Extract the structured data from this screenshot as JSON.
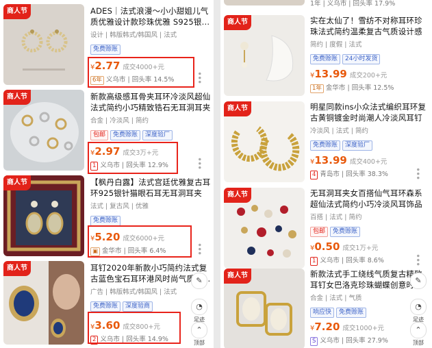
{
  "badge_label": "商人节",
  "left": [
    {
      "title": "ADES｜法式浪漫～小小甜姐儿气质优雅设计款珍珠优雅 S925银...",
      "tags": "设计 | 韩版韩式/韩国风 | 法式",
      "chips": [
        {
          "text": "免费赊账",
          "red": false
        }
      ],
      "currency": "¥",
      "price": "2.77",
      "sold": "成交4000+元",
      "meta_badge": "6年",
      "meta_badge_color": "orange",
      "market": "义乌市",
      "rate": "回头率 14.5%"
    },
    {
      "title": "新款高级感耳骨夹耳环冷淡风超仙法式简约小巧精致锆石无耳洞耳夹",
      "tags": "合金 | 冷淡风 | 简约",
      "chips": [
        {
          "text": "包邮",
          "red": true
        },
        {
          "text": "免费赊账",
          "red": false
        },
        {
          "text": "深度验厂",
          "red": false
        }
      ],
      "currency": "¥",
      "price": "2.97",
      "sold": "成交3万+元",
      "meta_badge": "1",
      "meta_badge_color": "red",
      "market": "义乌市",
      "rate": "回头率 12.9%"
    },
    {
      "title": "【枫丹白露】法式宫廷优雅复古耳环925银针猫眼石耳无耳洞耳夹",
      "tags": "法式 | 复古风 | 优雅",
      "chips": [
        {
          "text": "免费赊账",
          "red": false
        }
      ],
      "currency": "¥",
      "price": "5.20",
      "sold": "成交6000+元",
      "meta_badge": "",
      "meta_badge_color": "orange",
      "market": "金华市",
      "rate": "回头率 6.4%"
    },
    {
      "title": "耳钉2020年新款小巧简约法式复古蓝色宝石耳环港风时尚气质耳...",
      "tags": "广告 | 韩版韩式/韩国风 | 法式",
      "chips": [
        {
          "text": "免费赊账",
          "red": false
        },
        {
          "text": "深度验商",
          "red": false
        }
      ],
      "currency": "¥",
      "price": "3.60",
      "sold": "成交800+元",
      "meta_badge": "2",
      "meta_badge_color": "red",
      "market": "义乌市",
      "rate": "回头率 14.9%"
    }
  ],
  "right_top_meta": "1年 | 义乌市 | 回头率 17.9%",
  "right": [
    {
      "title": "实在太仙了！雪纺不对称耳环珍珠法式简约温柔复古气质设计感度假",
      "tags": "简约 | 度假 | 法式",
      "chips": [
        {
          "text": "免费赊账",
          "red": false
        },
        {
          "text": "24小时发货",
          "red": false
        }
      ],
      "currency": "¥",
      "price": "13.99",
      "sold": "成交200+元",
      "meta_badge": "1年",
      "meta_badge_color": "orange",
      "market": "金华市",
      "rate": "回头率 12.5%"
    },
    {
      "title": "明星同款ins小众法式编织耳环复古黄铜镀金时尚潮人冷淡风耳钉",
      "tags": "冷淡风 | 法式 | 简约",
      "chips": [
        {
          "text": "免费赊账",
          "red": false
        },
        {
          "text": "深度验厂",
          "red": false
        }
      ],
      "currency": "¥",
      "price": "13.99",
      "sold": "成交400+元",
      "meta_badge": "4",
      "meta_badge_color": "red",
      "market": "青岛市",
      "rate": "回头率 38.3%"
    },
    {
      "title": "无耳洞耳夹女百搭仙气耳环森系超仙法式简约小巧冷淡风耳饰品",
      "tags": "百搭 | 法式 | 简约",
      "chips": [
        {
          "text": "包邮",
          "red": true
        },
        {
          "text": "免费赊账",
          "red": false
        }
      ],
      "currency": "¥",
      "price": "0.50",
      "sold": "成交1万+元",
      "meta_badge": "1",
      "meta_badge_color": "red",
      "market": "义乌市",
      "rate": "回头率 8.6%"
    },
    {
      "title": "新款法式手工绕线气质复古精致耳钉女巴洛克珍珠蝴蝶创意时尚耳...",
      "tags": "合金 | 法式 | 气质",
      "chips": [
        {
          "text": "响应快",
          "red": false
        },
        {
          "text": "免费赊账",
          "red": false
        }
      ],
      "currency": "¥",
      "price": "7.20",
      "sold": "成交1000+元",
      "meta_badge": "S",
      "meta_badge_color": "purple",
      "market": "义乌市",
      "rate": "回头率 27.9%"
    }
  ],
  "floating": {
    "footprint": "足迹",
    "top": "顶部"
  },
  "more_glyph": "•••",
  "icons": {
    "more": "more-dots-icon",
    "footprint": "footprint-icon",
    "top": "back-to-top-icon",
    "report": "report-icon"
  }
}
